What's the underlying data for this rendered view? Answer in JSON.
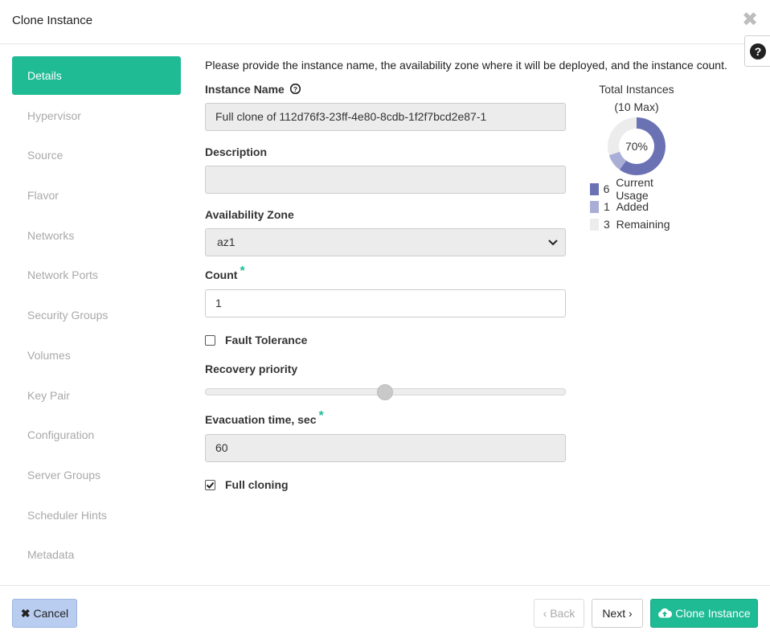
{
  "header": {
    "title": "Clone Instance",
    "close_icon": "close-icon",
    "help_icon": "question-circle-icon"
  },
  "sidebar": {
    "items": [
      {
        "label": "Details",
        "active": true
      },
      {
        "label": "Hypervisor"
      },
      {
        "label": "Source"
      },
      {
        "label": "Flavor"
      },
      {
        "label": "Networks"
      },
      {
        "label": "Network Ports"
      },
      {
        "label": "Security Groups"
      },
      {
        "label": "Volumes"
      },
      {
        "label": "Key Pair"
      },
      {
        "label": "Configuration"
      },
      {
        "label": "Server Groups"
      },
      {
        "label": "Scheduler Hints"
      },
      {
        "label": "Metadata"
      }
    ]
  },
  "form": {
    "intro": "Please provide the instance name, the availability zone where it will be deployed, and the instance count.",
    "instance_name": {
      "label": "Instance Name",
      "value": "Full clone of 112d76f3-23ff-4e80-8cdb-1f2f7bcd2e87-1"
    },
    "description": {
      "label": "Description",
      "value": ""
    },
    "availability_zone": {
      "label": "Availability Zone",
      "value": "az1"
    },
    "count": {
      "label": "Count",
      "required_mark": "*",
      "value": "1"
    },
    "fault_tolerance": {
      "label": "Fault Tolerance",
      "checked": false
    },
    "recovery_priority": {
      "label": "Recovery priority",
      "level": 0.5
    },
    "evacuation_time": {
      "label": "Evacuation time, sec",
      "required_mark": "*",
      "value": "60"
    },
    "full_cloning": {
      "label": "Full cloning",
      "checked": true
    }
  },
  "quota": {
    "title_line1": "Total Instances",
    "title_line2": "(10 Max)",
    "percent_label": "70%",
    "current_usage": 6,
    "added": 1,
    "remaining": 3,
    "legend": [
      {
        "count": "6",
        "label": "Current Usage",
        "color": "#6b72b4"
      },
      {
        "count": "1",
        "label": "Added",
        "color": "#a9aed6"
      },
      {
        "count": "3",
        "label": "Remaining",
        "color": "#ececec"
      }
    ]
  },
  "footer": {
    "cancel_label": "Cancel",
    "back_label": "Back",
    "next_label": "Next",
    "clone_label": "Clone Instance"
  },
  "colors": {
    "accent": "#1fbb95",
    "cancel_bg": "#b9cdf0"
  }
}
